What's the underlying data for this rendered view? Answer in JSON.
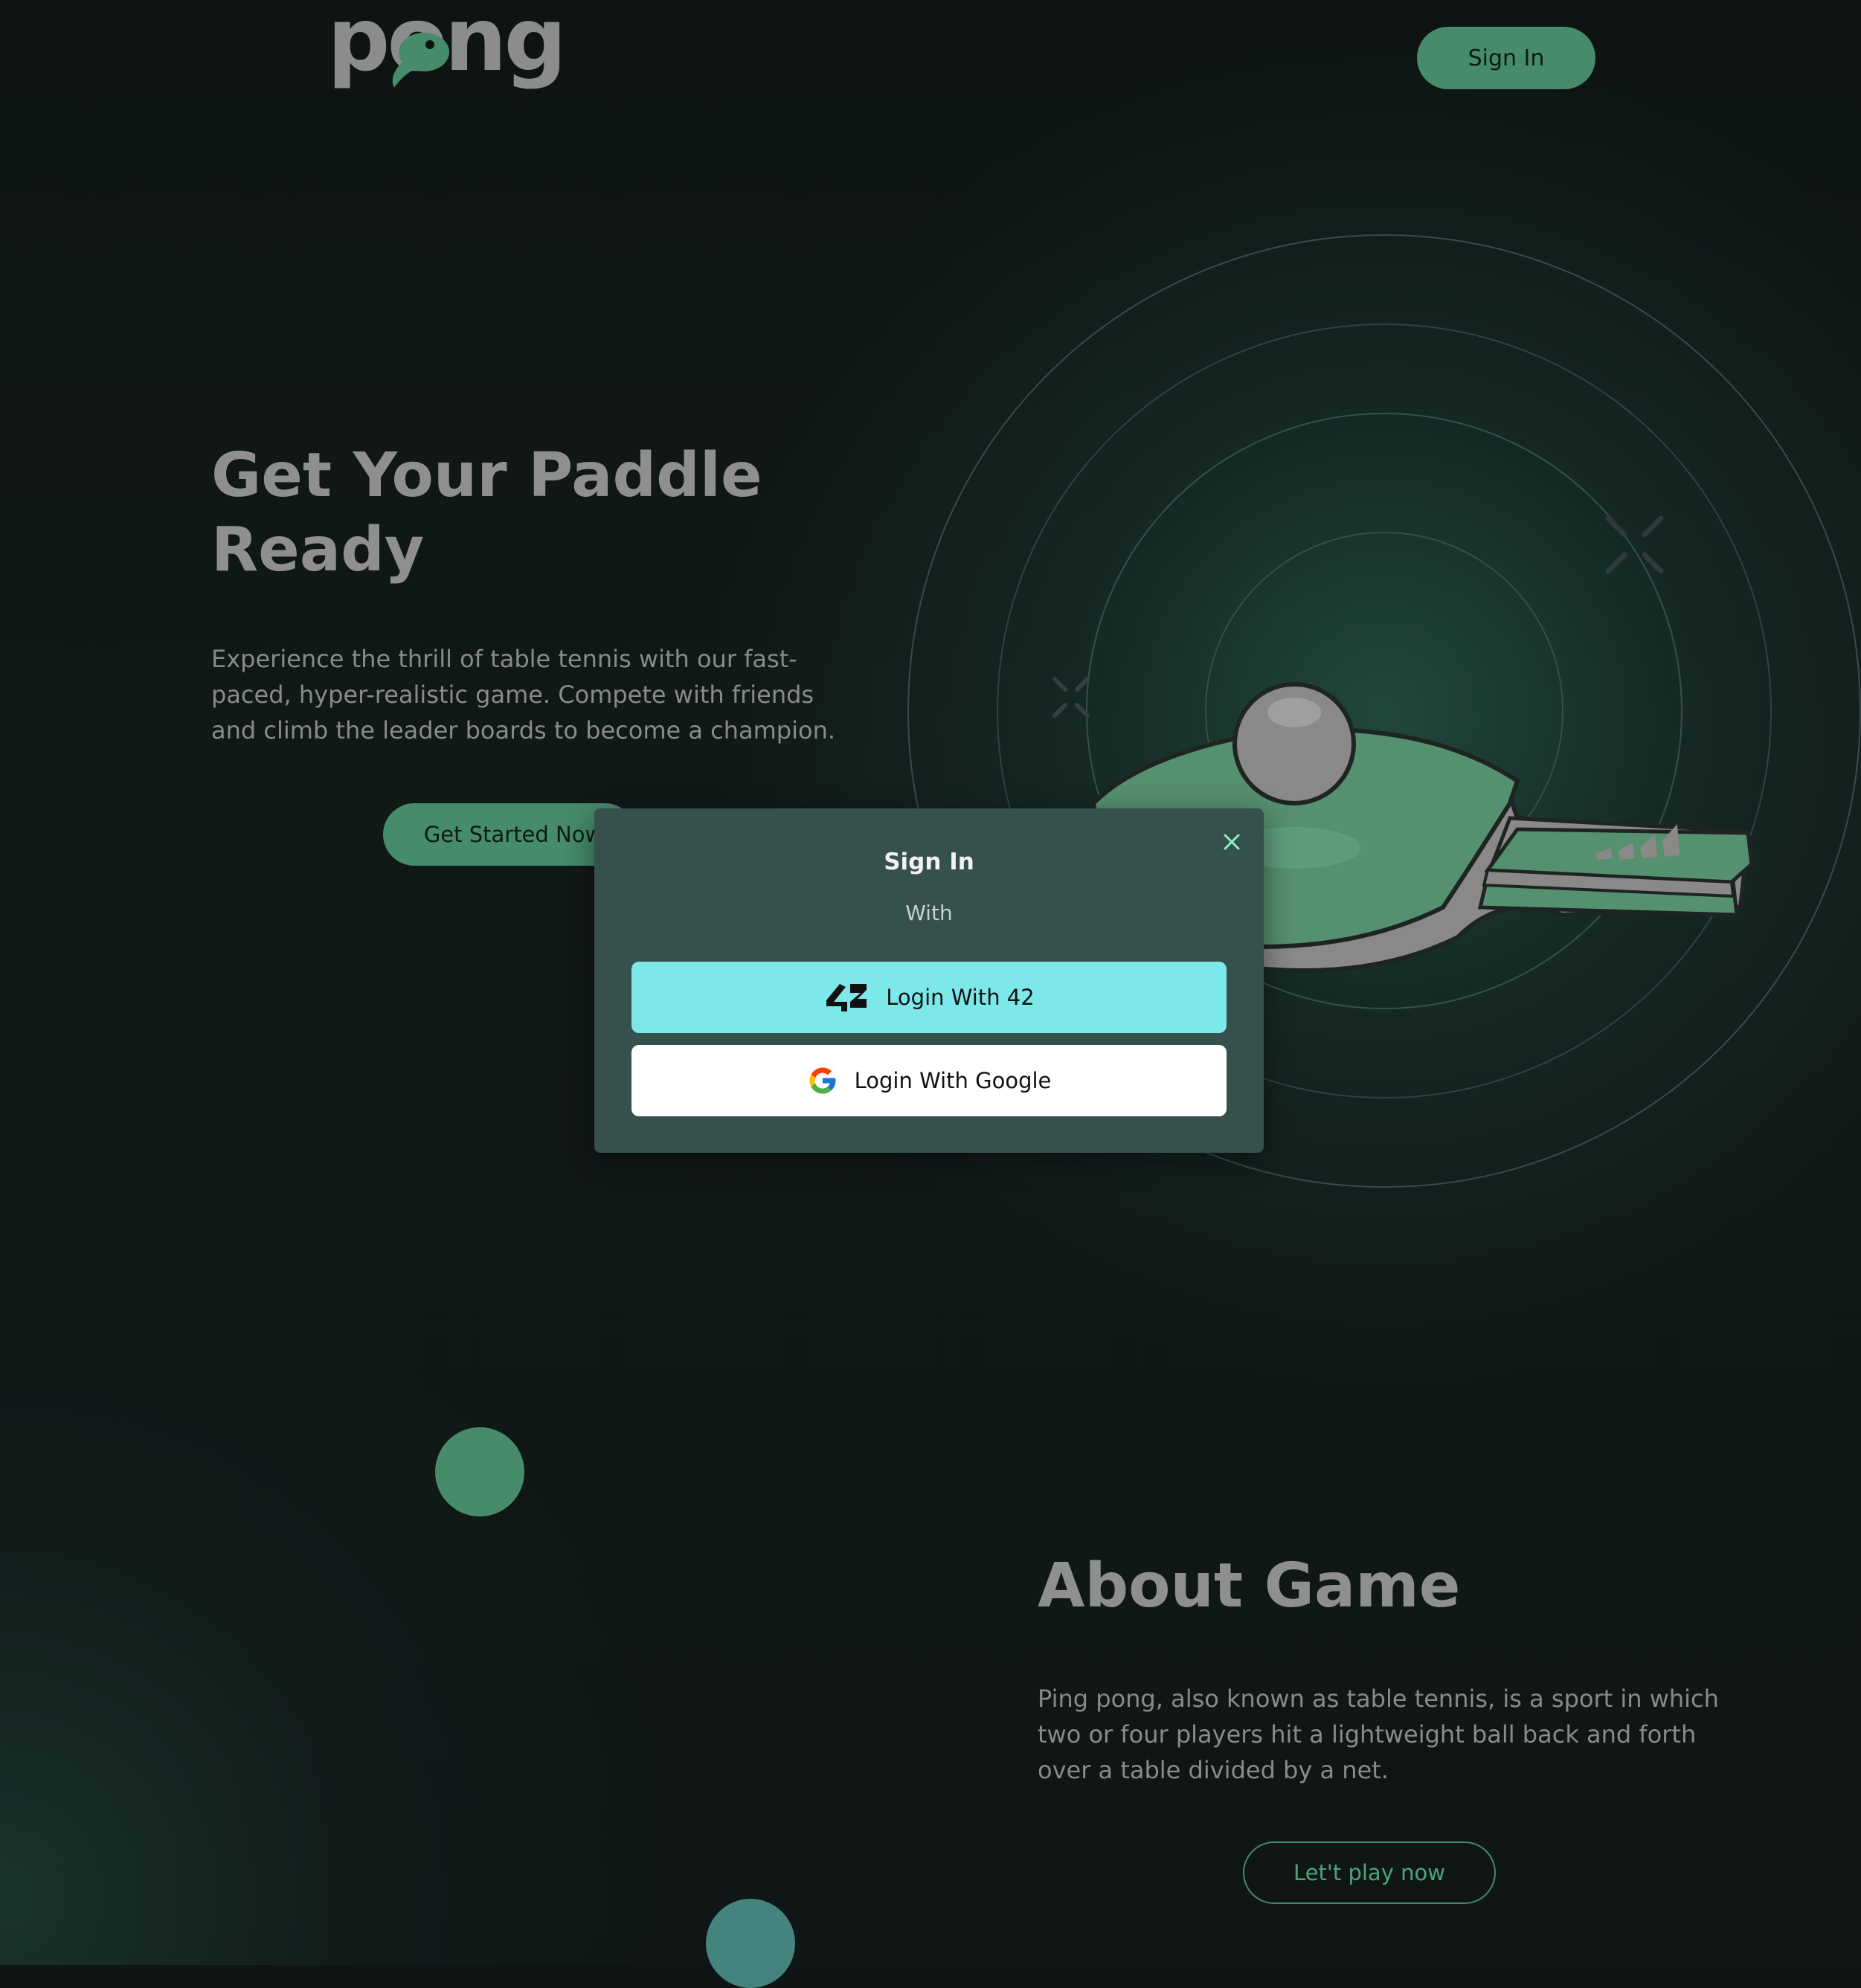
{
  "header": {
    "logo_text": "pong",
    "sign_in_label": "Sign In"
  },
  "hero": {
    "title": "Get Your Paddle Ready",
    "description": "Experience the thrill of table tennis with our fast-paced, hyper-realistic game. Compete with friends and climb the leader boards to become a champion.",
    "cta_label": "Get Started Now"
  },
  "modal": {
    "title": "Sign In",
    "subtitle": "With",
    "buttons": [
      {
        "label": "Login With 42",
        "icon": "42-logo-icon",
        "background": "#7de8ea"
      },
      {
        "label": "Login With Google",
        "icon": "google-logo-icon",
        "background": "#ffffff"
      }
    ],
    "close_icon": "close-icon"
  },
  "about": {
    "title": "About Game",
    "description": "Ping pong, also known as table tennis, is a sport in which two or four players hit a lightweight ball back and forth over a table divided by a net.",
    "cta_label": "Let't play now"
  },
  "colors": {
    "accent": "#468b6a",
    "background": "#0f1515",
    "modal_bg": "#35504d",
    "button_42": "#7de8ea",
    "text_muted": "#8a8a8a"
  }
}
